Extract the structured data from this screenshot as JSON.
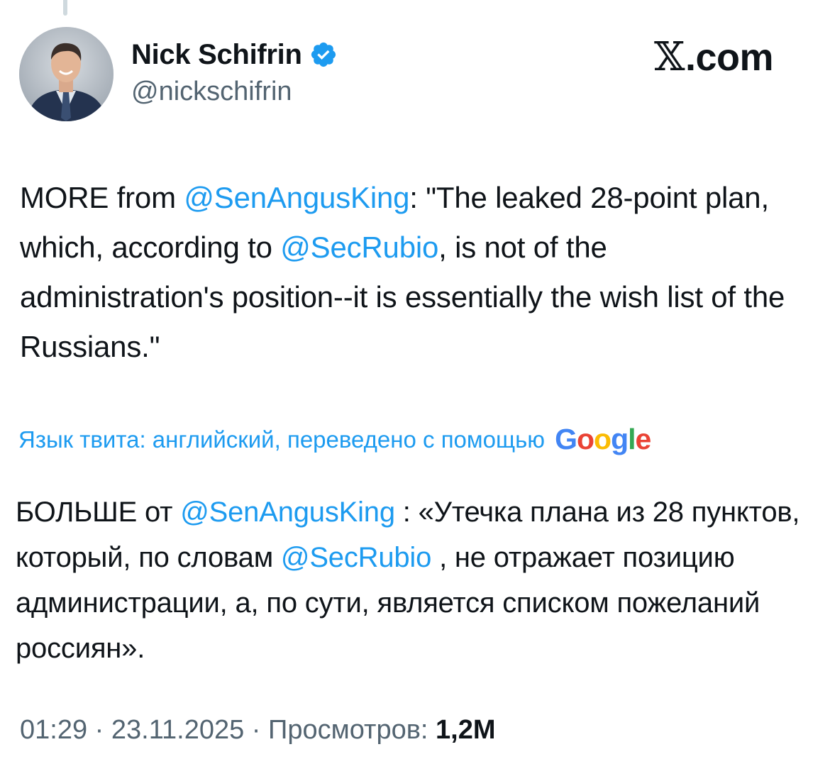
{
  "author": {
    "name": "Nick Schifrin",
    "handle": "@nickschifrin",
    "verified": true
  },
  "watermark": {
    "x_glyph": "𝕏",
    "domain": ".com"
  },
  "tweet": {
    "segments": [
      {
        "text": "MORE from ",
        "type": "text"
      },
      {
        "text": "@SenAngusKing",
        "type": "mention"
      },
      {
        "text": ": \"The leaked 28-point plan, which, according to ",
        "type": "text"
      },
      {
        "text": "@SecRubio",
        "type": "mention"
      },
      {
        "text": ", is not of the administration's position--it is essentially the wish list of the Russians.\"",
        "type": "text"
      }
    ]
  },
  "translation": {
    "label": "Язык твита: английский, переведено с помощью",
    "provider_letters": [
      "G",
      "o",
      "o",
      "g",
      "l",
      "e"
    ],
    "segments": [
      {
        "text": "БОЛЬШЕ от ",
        "type": "text"
      },
      {
        "text": "@SenAngusKing",
        "type": "mention"
      },
      {
        "text": " : «Утечка плана из 28 пунктов, который, по словам ",
        "type": "text"
      },
      {
        "text": "@SecRubio",
        "type": "mention"
      },
      {
        "text": " , не отражает позицию администрации, а, по сути, является списком пожеланий россиян».",
        "type": "text"
      }
    ]
  },
  "meta": {
    "time": "01:29",
    "separator": " · ",
    "date": "23.11.2025",
    "views_label": "Просмотров:",
    "views_count": "1,2M"
  },
  "colors": {
    "accent": "#1d9bf0",
    "text": "#0f1419",
    "secondary": "#536471"
  }
}
